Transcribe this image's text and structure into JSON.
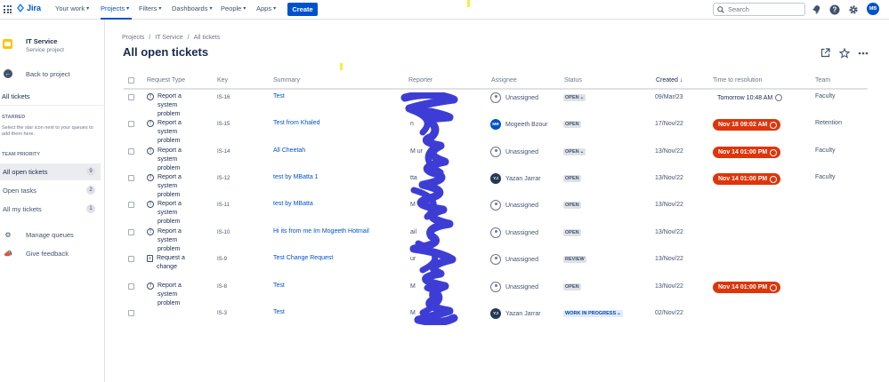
{
  "topnav": {
    "logo": "Jira",
    "items": [
      "Your work",
      "Projects",
      "Filters",
      "Dashboards",
      "People",
      "Apps"
    ],
    "create": "Create",
    "search_placeholder": "Search",
    "avatar": "MB"
  },
  "sidebar": {
    "project_name": "IT Service",
    "project_type": "Service project",
    "back": "Back to project",
    "current": "All tickets",
    "starred_head": "STARRED",
    "starred_note": "Select the star icon next to your queues to add them here.",
    "priority_head": "TEAM PRIORITY",
    "queues": [
      {
        "label": "All open tickets",
        "count": "9"
      },
      {
        "label": "Open tasks",
        "count": "2"
      },
      {
        "label": "All my tickets",
        "count": "1"
      }
    ],
    "manage": "Manage queues",
    "feedback": "Give feedback"
  },
  "main": {
    "breadcrumb": [
      "Projects",
      "/",
      "IT Service",
      "/",
      "All tickets"
    ],
    "title": "All open tickets",
    "columns": {
      "type": "Request Type",
      "key": "Key",
      "summary": "Summary",
      "reporter": "Reporter",
      "assignee": "Assignee",
      "status": "Status",
      "created": "Created",
      "ttr": "Time to resolution",
      "team": "Team"
    }
  },
  "rows": [
    {
      "type": "Report a system problem",
      "key": "IS-16",
      "summary": "Test",
      "reporter": "",
      "assignee": "Unassigned",
      "av": "",
      "status": "OPEN",
      "dd": "⌄",
      "created": "09/Mar/23",
      "ttr": "Tomorrow 10:48 AM",
      "team": "Faculty"
    },
    {
      "type": "Report a system problem",
      "key": "IS-15",
      "summary": "Test from Khaled",
      "reporter": "n",
      "assignee": "Mogeeth Bzour",
      "av": "MB",
      "status": "OPEN",
      "dd": "",
      "created": "17/Nov/22",
      "ttr": "Nov 18 09:02 AM",
      "team": "Retention"
    },
    {
      "type": "Report a system problem",
      "key": "IS-14",
      "summary": "All Cheetah",
      "reporter": "M ur",
      "assignee": "Unassigned",
      "av": "",
      "status": "OPEN",
      "dd": "⌄",
      "created": "13/Nov/22",
      "ttr": "Nov 14 01:00 PM",
      "team": "Faculty"
    },
    {
      "type": "Report a system problem",
      "key": "IS-12",
      "summary": "test by MBatta 1",
      "reporter": "tta",
      "assignee": "Yazan Jarrar",
      "av": "YJ",
      "status": "OPEN",
      "dd": "",
      "created": "13/Nov/22",
      "ttr": "Nov 14 01:00 PM",
      "team": "Faculty"
    },
    {
      "type": "Report a system problem",
      "key": "IS-11",
      "summary": "test by MBatta",
      "reporter": "M",
      "assignee": "Unassigned",
      "av": "",
      "status": "OPEN",
      "dd": "",
      "created": "13/Nov/22",
      "ttr": "",
      "team": ""
    },
    {
      "type": "Report a system problem",
      "key": "IS-10",
      "summary": "Hi its from me Im Mogeeth Hotmail",
      "reporter": "ail",
      "assignee": "Unassigned",
      "av": "",
      "status": "OPEN",
      "dd": "",
      "created": "13/Nov/22",
      "ttr": "",
      "team": ""
    },
    {
      "type": "Request a change",
      "key": "IS-9",
      "summary": "Test Change Request",
      "reporter": "ur",
      "assignee": "Unassigned",
      "av": "",
      "status": "REVIEW",
      "dd": "",
      "created": "13/Nov/22",
      "ttr": "",
      "team": ""
    },
    {
      "type": "Report a system problem",
      "key": "IS-8",
      "summary": "Test",
      "reporter": "M",
      "assignee": "Unassigned",
      "av": "",
      "status": "OPEN",
      "dd": "",
      "created": "13/Nov/22",
      "ttr": "Nov 14 01:00 PM",
      "team": ""
    },
    {
      "type": "",
      "key": "IS-3",
      "summary": "Test",
      "reporter": "M",
      "assignee": "Yazan Jarrar",
      "av": "YJ",
      "status": "WORK IN PROGRESS",
      "dd": "⌄",
      "created": "02/Nov/22",
      "ttr": "",
      "team": ""
    }
  ],
  "colors": {
    "accent": "#0052cc",
    "sla_red": "#de350b",
    "scribble": "#3d3dd6"
  }
}
